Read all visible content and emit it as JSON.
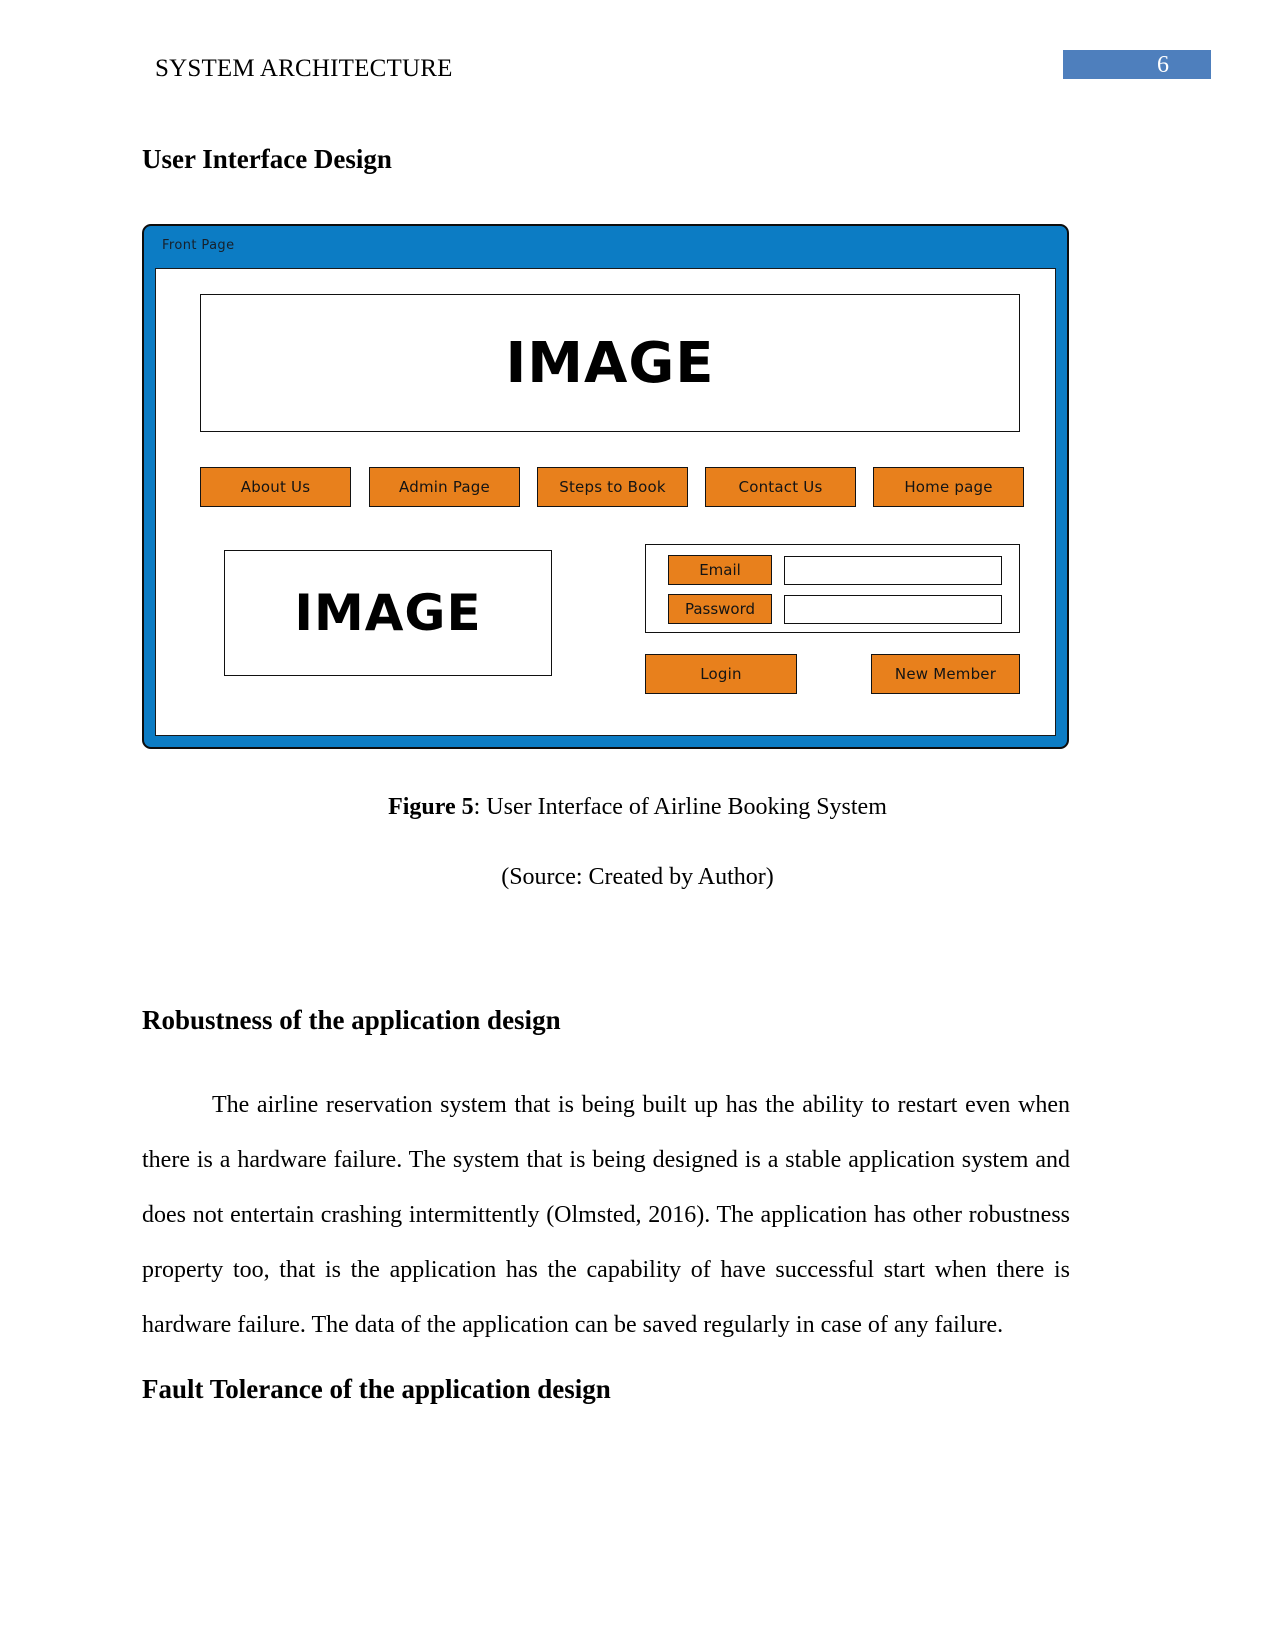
{
  "header": {
    "running_title": "SYSTEM ARCHITECTURE",
    "page_number": "6",
    "page_number_bg": "#4e7fbd"
  },
  "headings": {
    "ui_design": "User Interface Design",
    "robustness": "Robustness of the application design",
    "fault_tolerance": "Fault Tolerance of the application design"
  },
  "mockup": {
    "window_title": "Front Page",
    "window_bg": "#0c7cc4",
    "button_bg": "#e8801c",
    "banner_image_label": "IMAGE",
    "secondary_image_label": "IMAGE",
    "nav_buttons": [
      {
        "label": "About Us"
      },
      {
        "label": "Admin Page"
      },
      {
        "label": "Steps to Book"
      },
      {
        "label": "Contact Us"
      },
      {
        "label": "Home page"
      }
    ],
    "login": {
      "email_label": "Email",
      "email_value": "",
      "password_label": "Password",
      "password_value": "",
      "login_button": "Login",
      "new_member_button": "New Member"
    }
  },
  "captions": {
    "figure_label": "Figure 5",
    "figure_text": ": User Interface of Airline Booking System",
    "source": "(Source: Created by Author)"
  },
  "body": {
    "robustness_paragraph": "The airline reservation system that is being built up has the ability to restart even when there is a hardware failure. The system that is being designed is a stable application system and does not entertain crashing intermittently (Olmsted, 2016). The application has other robustness property too, that is the application has the capability of have successful start when there is hardware failure. The data of the application can be saved regularly in case of any failure."
  }
}
